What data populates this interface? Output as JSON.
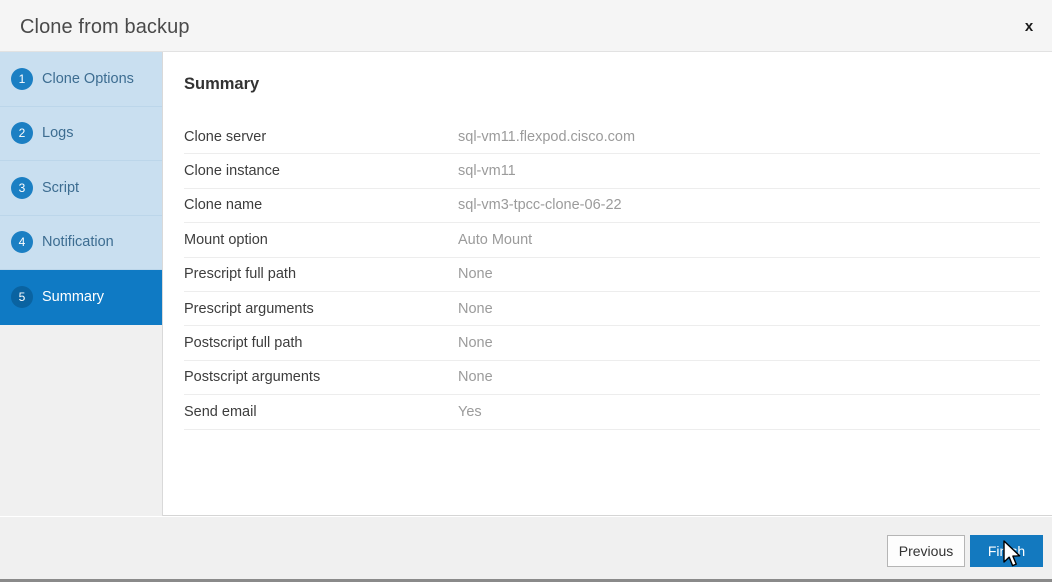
{
  "window": {
    "title": "Clone from backup",
    "close_icon": "close-icon",
    "close_label": "x"
  },
  "sidebar": {
    "steps": [
      {
        "number": "1",
        "label": "Clone Options",
        "active": false
      },
      {
        "number": "2",
        "label": "Logs",
        "active": false
      },
      {
        "number": "3",
        "label": "Script",
        "active": false
      },
      {
        "number": "4",
        "label": "Notification",
        "active": false
      },
      {
        "number": "5",
        "label": "Summary",
        "active": true
      }
    ]
  },
  "main": {
    "section_title": "Summary",
    "rows": [
      {
        "label": "Clone server",
        "value": "sql-vm11.flexpod.cisco.com"
      },
      {
        "label": "Clone instance",
        "value": "sql-vm11"
      },
      {
        "label": "Clone name",
        "value": "sql-vm3-tpcc-clone-06-22"
      },
      {
        "label": "Mount option",
        "value": "Auto Mount"
      },
      {
        "label": "Prescript full path",
        "value": "None"
      },
      {
        "label": "Prescript arguments",
        "value": "None"
      },
      {
        "label": "Postscript full path",
        "value": "None"
      },
      {
        "label": "Postscript arguments",
        "value": "None"
      },
      {
        "label": "Send email",
        "value": "Yes"
      }
    ]
  },
  "footer": {
    "previous_label": "Previous",
    "finish_label": "Finish"
  },
  "colors": {
    "accent": "#0f7ac4",
    "badge": "#1b7fc3",
    "primary_button": "#1379bf",
    "sidebar_background": "#c9dff0",
    "step_label": "#3d6d91"
  }
}
